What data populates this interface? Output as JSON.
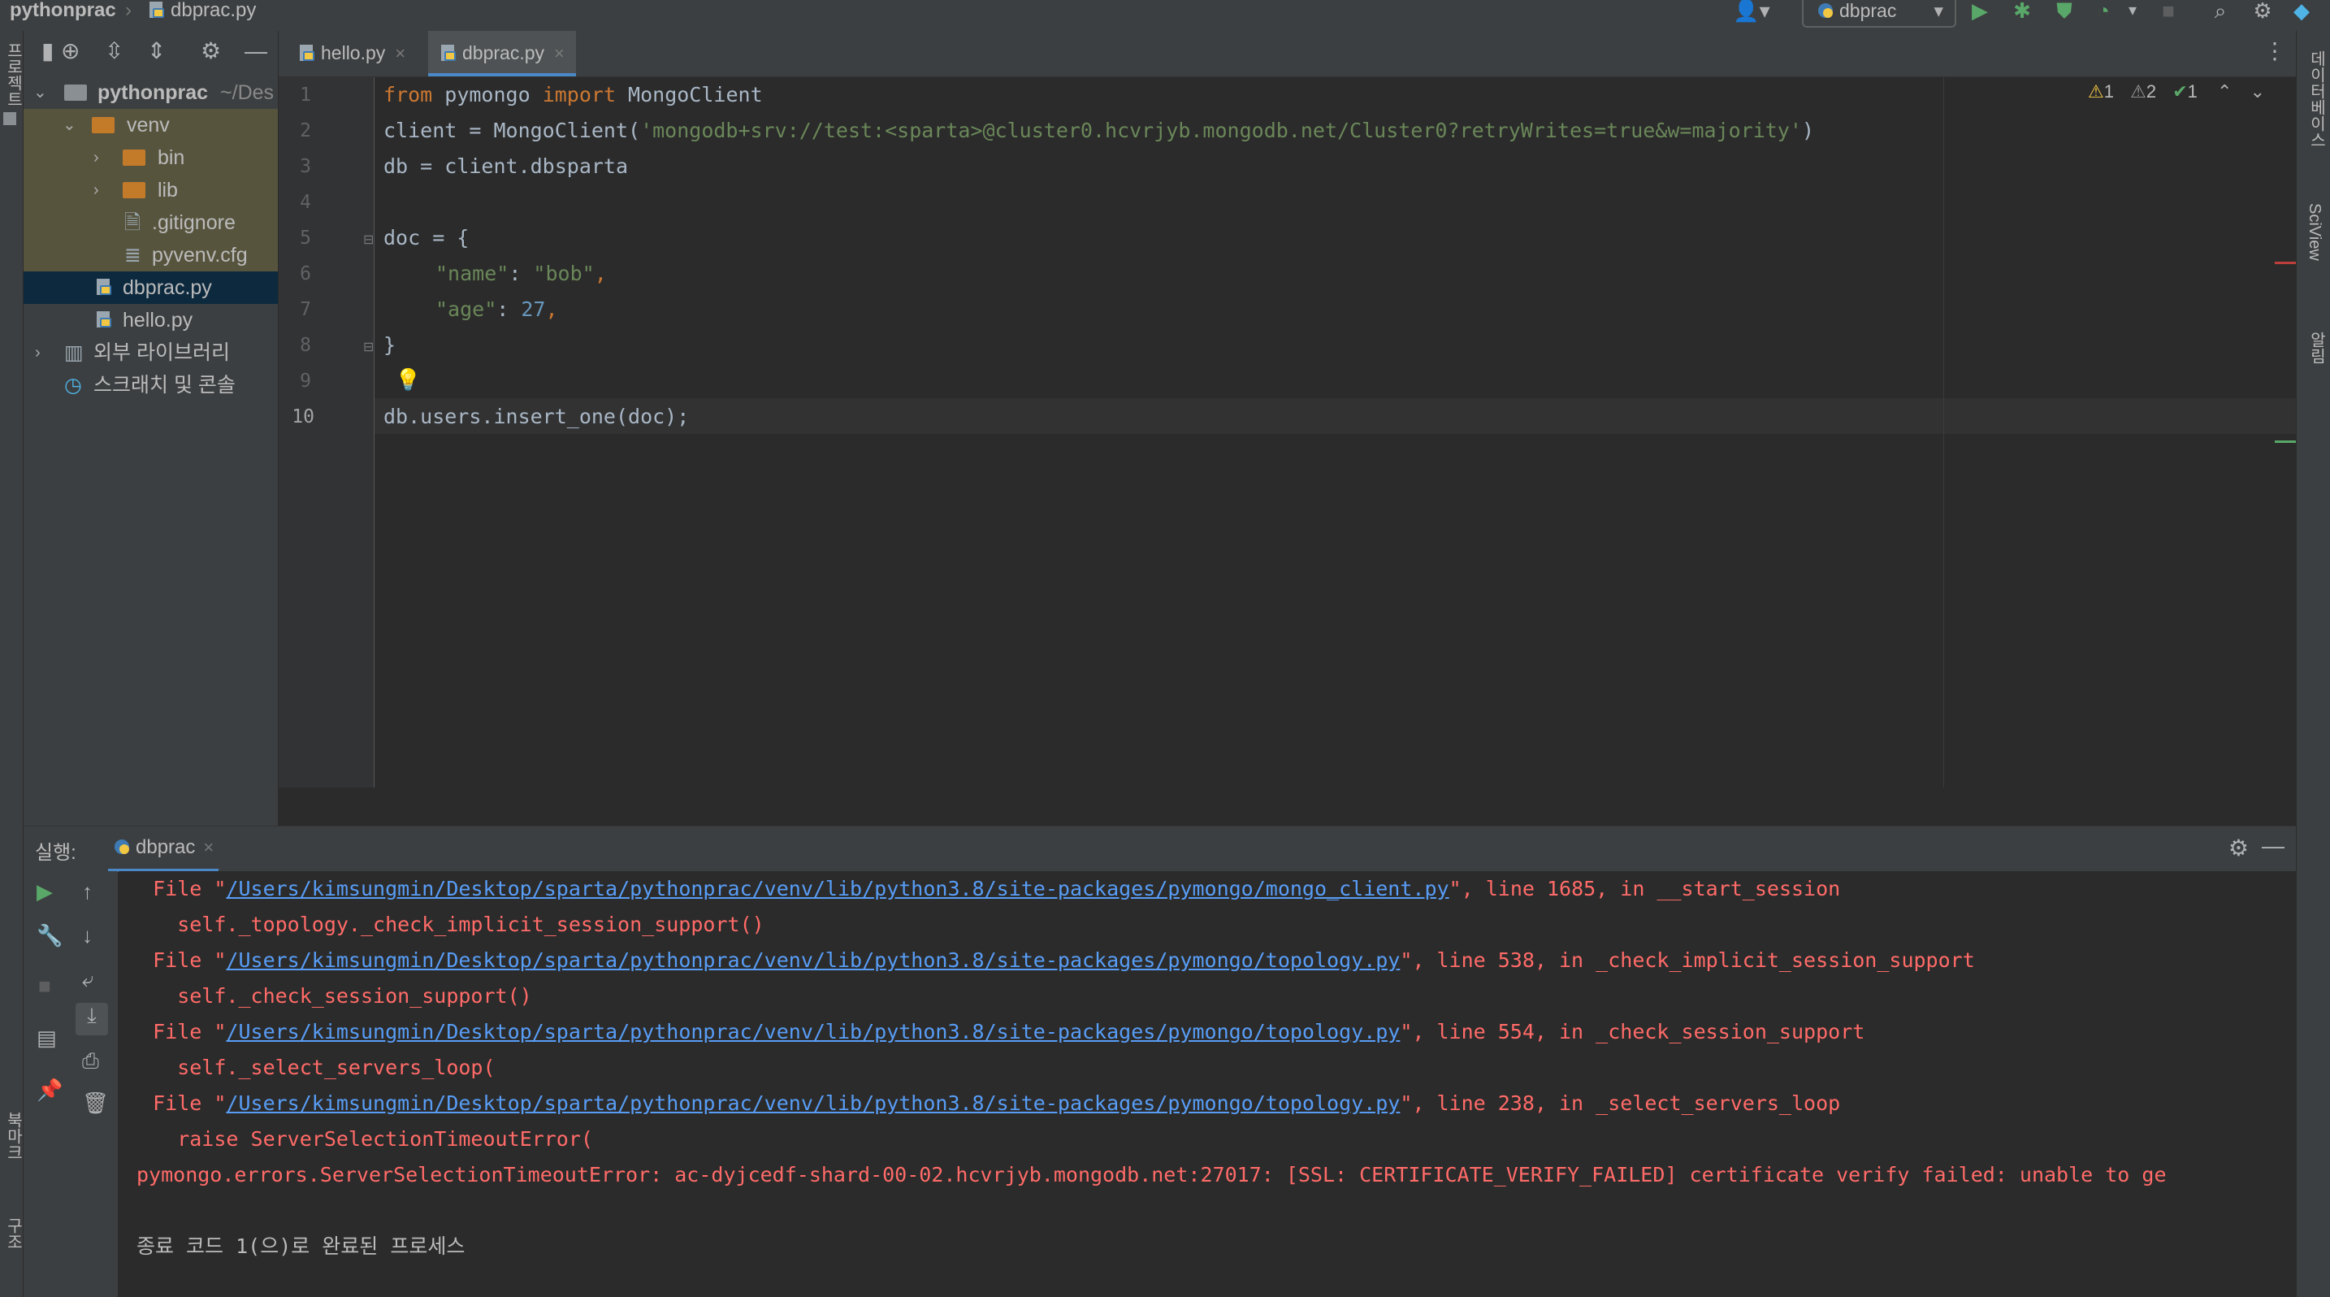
{
  "breadcrumb": {
    "project": "pythonprac",
    "file": "dbprac.py"
  },
  "toolbar": {
    "run_config": "dbprac"
  },
  "left_stripe": {
    "project_label": "프로젝트",
    "bookmarks_label": "북마크",
    "structure_label": "구조"
  },
  "right_stripe": {
    "database_label": "데이터베이스",
    "sciview_label": "SciView",
    "notifications_label": "알림"
  },
  "project_tree": {
    "root": {
      "label": "pythonprac",
      "path": "~/Des"
    },
    "venv": "venv",
    "bin": "bin",
    "lib": "lib",
    "gitignore": ".gitignore",
    "pyvenv": "pyvenv.cfg",
    "dbprac": "dbprac.py",
    "hello": "hello.py",
    "external": "외부 라이브러리",
    "scratches": "스크래치 및 콘솔"
  },
  "tabs": [
    {
      "label": "hello.py"
    },
    {
      "label": "dbprac.py"
    }
  ],
  "inspections": {
    "warn1": "1",
    "warn2": "2",
    "ok": "1"
  },
  "editor": {
    "line_numbers": [
      "1",
      "2",
      "3",
      "4",
      "5",
      "6",
      "7",
      "8",
      "9",
      "10"
    ],
    "l1": {
      "kw1": "from",
      "mod": " pymongo ",
      "kw2": "import",
      "cls": " MongoClient"
    },
    "l2": {
      "pre": "client = MongoClient(",
      "str": "'mongodb+srv://test:<sparta>@cluster0.hcvrjyb.mongodb.net/Cluster0?retryWrites=true&w=majority'",
      "post": ")"
    },
    "l3": "db = client.dbsparta",
    "l5": "doc = {",
    "l6": {
      "key": "\"name\"",
      "sep": ": ",
      "val": "\"bob\"",
      "end": ","
    },
    "l7": {
      "key": "\"age\"",
      "sep": ": ",
      "val": "27",
      "end": ","
    },
    "l8": "}",
    "l10": "db.users.insert_one(doc);"
  },
  "run": {
    "label": "실행:",
    "config": "dbprac",
    "output": [
      {
        "prefix": "  File \"",
        "link": "/Users/kimsungmin/Desktop/sparta/pythonprac/venv/lib/python3.8/site-packages/pymongo/mongo_client.py",
        "suffix": "\", line 1685, in __start_session"
      },
      {
        "text": "    self._topology._check_implicit_session_support()"
      },
      {
        "prefix": "  File \"",
        "link": "/Users/kimsungmin/Desktop/sparta/pythonprac/venv/lib/python3.8/site-packages/pymongo/topology.py",
        "suffix": "\", line 538, in _check_implicit_session_support"
      },
      {
        "text": "    self._check_session_support()"
      },
      {
        "prefix": "  File \"",
        "link": "/Users/kimsungmin/Desktop/sparta/pythonprac/venv/lib/python3.8/site-packages/pymongo/topology.py",
        "suffix": "\", line 554, in _check_session_support"
      },
      {
        "text": "    self._select_servers_loop("
      },
      {
        "prefix": "  File \"",
        "link": "/Users/kimsungmin/Desktop/sparta/pythonprac/venv/lib/python3.8/site-packages/pymongo/topology.py",
        "suffix": "\", line 238, in _select_servers_loop"
      },
      {
        "text": "    raise ServerSelectionTimeoutError("
      },
      {
        "text": "pymongo.errors.ServerSelectionTimeoutError: ac-dyjcedf-shard-00-02.hcvrjyb.mongodb.net:27017: [SSL: CERTIFICATE_VERIFY_FAILED] certificate verify failed: unable to ge"
      }
    ],
    "exit_message": "종료 코드 1(으)로 완료된 프로세스"
  }
}
